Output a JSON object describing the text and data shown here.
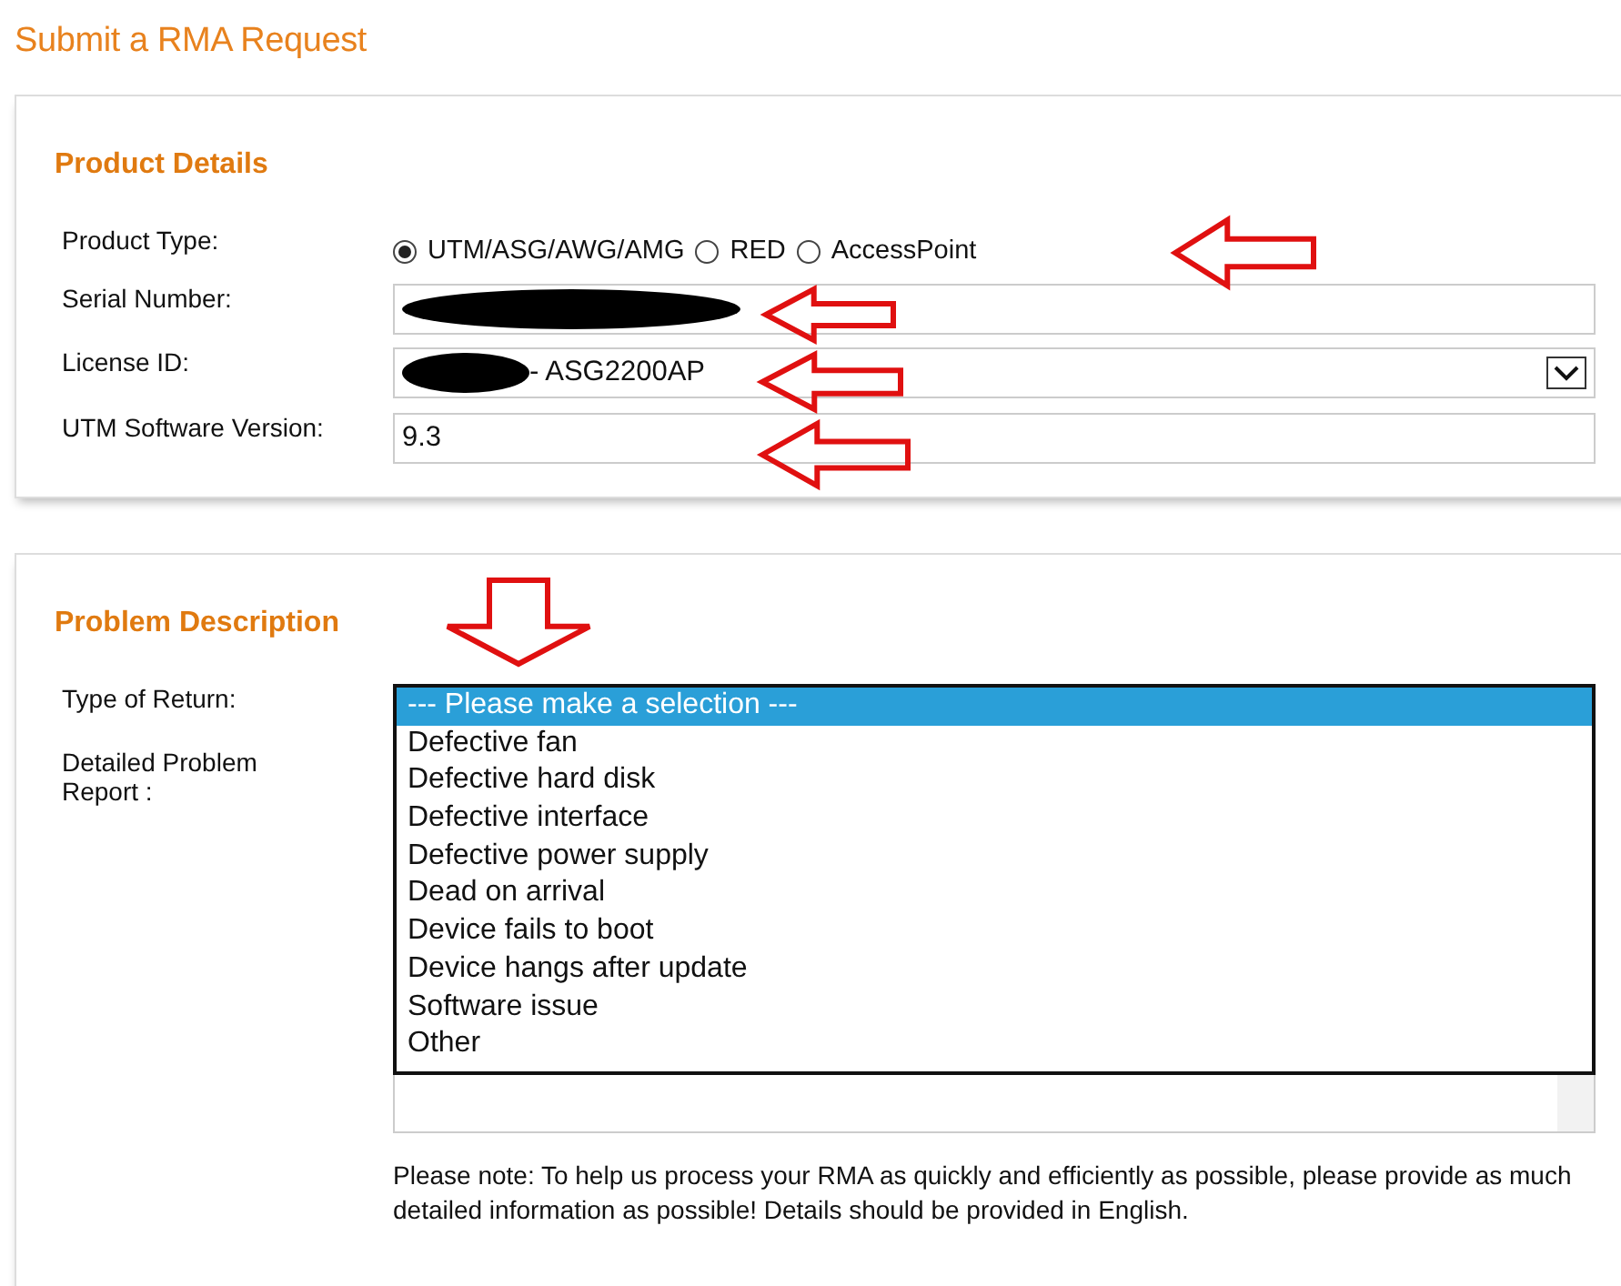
{
  "page_title": "Submit a RMA Request",
  "product_details": {
    "heading": "Product Details",
    "product_type": {
      "label": "Product Type:",
      "options": [
        {
          "label": "UTM/ASG/AWG/AMG",
          "selected": true
        },
        {
          "label": "RED",
          "selected": false
        },
        {
          "label": "AccessPoint",
          "selected": false
        }
      ]
    },
    "serial_number": {
      "label": "Serial Number:",
      "redacted": true
    },
    "license_id": {
      "label": "License ID:",
      "redacted": true,
      "value": "- ASG2200AP"
    },
    "software_version": {
      "label": "UTM Software Version:",
      "value": "9.3"
    }
  },
  "problem_description": {
    "heading": "Problem Description",
    "type_of_return": {
      "label": "Type of Return:",
      "options": [
        {
          "label": "--- Please make a selection ---",
          "selected": true
        },
        {
          "label": "Defective fan",
          "selected": false
        },
        {
          "label": "Defective hard disk",
          "selected": false
        },
        {
          "label": "Defective interface",
          "selected": false
        },
        {
          "label": "Defective power supply",
          "selected": false
        },
        {
          "label": "Dead on arrival",
          "selected": false
        },
        {
          "label": "Device fails to boot",
          "selected": false
        },
        {
          "label": "Device hangs after update",
          "selected": false
        },
        {
          "label": "Software issue",
          "selected": false
        },
        {
          "label": "Other",
          "selected": false
        }
      ]
    },
    "detailed_report": {
      "label": "Detailed Problem Report :"
    },
    "note": "Please note: To help us process your RMA as quickly and efficiently as possible, please provide as much detailed information as possible! Details should be provided in English."
  },
  "annotations": [
    {
      "kind": "left"
    },
    {
      "kind": "left"
    },
    {
      "kind": "left"
    },
    {
      "kind": "left"
    },
    {
      "kind": "down"
    }
  ]
}
